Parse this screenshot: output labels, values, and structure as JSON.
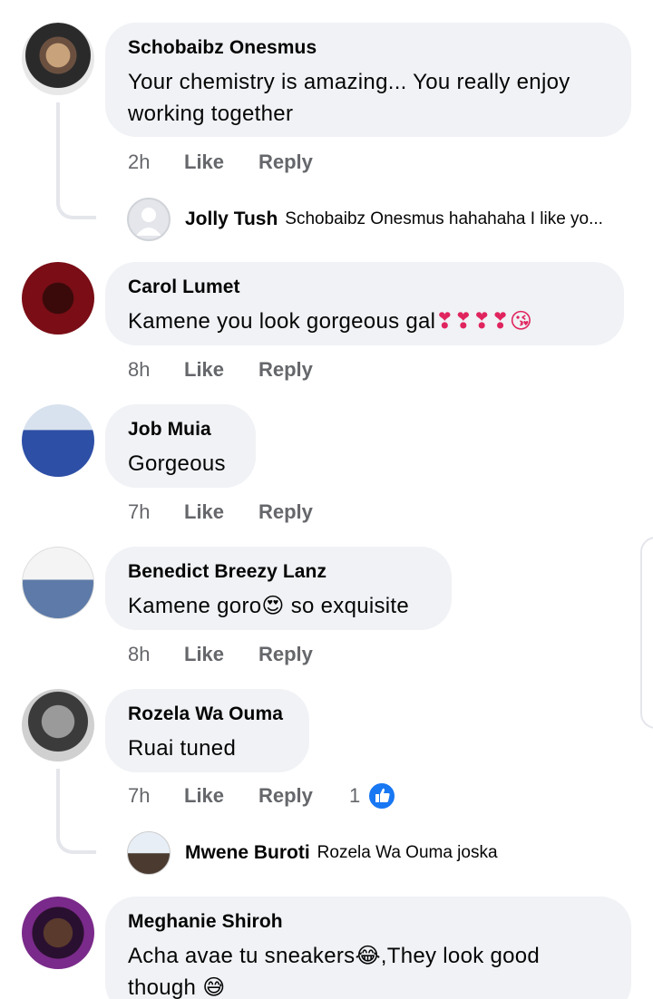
{
  "comments": [
    {
      "author": "Schobaibz Onesmus",
      "text": "Your chemistry is amazing... You really enjoy working together",
      "time": "2h",
      "like_label": "Like",
      "reply_label": "Reply",
      "reply": {
        "author": "Jolly Tush",
        "text": "Schobaibz Onesmus hahahaha I like yo..."
      }
    },
    {
      "author": "Carol Lumet",
      "text": "Kamene you look gorgeous gal",
      "emoji": "❣❣❣❣😘",
      "time": "8h",
      "like_label": "Like",
      "reply_label": "Reply"
    },
    {
      "author": "Job Muia",
      "text": "Gorgeous",
      "time": "7h",
      "like_label": "Like",
      "reply_label": "Reply"
    },
    {
      "author": "Benedict Breezy Lanz",
      "text_before": "Kamene goro",
      "emoji": "😍",
      "text_after": " so exquisite",
      "time": "8h",
      "like_label": "Like",
      "reply_label": "Reply"
    },
    {
      "author": "Rozela Wa Ouma",
      "text": "Ruai tuned",
      "time": "7h",
      "like_label": "Like",
      "reply_label": "Reply",
      "reaction_count": "1",
      "reply": {
        "author": "Mwene Buroti",
        "text": "Rozela Wa Ouma joska"
      }
    },
    {
      "author": "Meghanie Shiroh",
      "text_before": "Acha avae tu sneakers",
      "emoji": "😂",
      "text_after": ",They look good",
      "text_line2": "though ",
      "emoji2": "😅"
    }
  ],
  "colors": {
    "bubble": "#f0f2f5",
    "meta": "#65676b",
    "like_blue": "#1877f2",
    "thread_line": "#e4e6eb"
  }
}
